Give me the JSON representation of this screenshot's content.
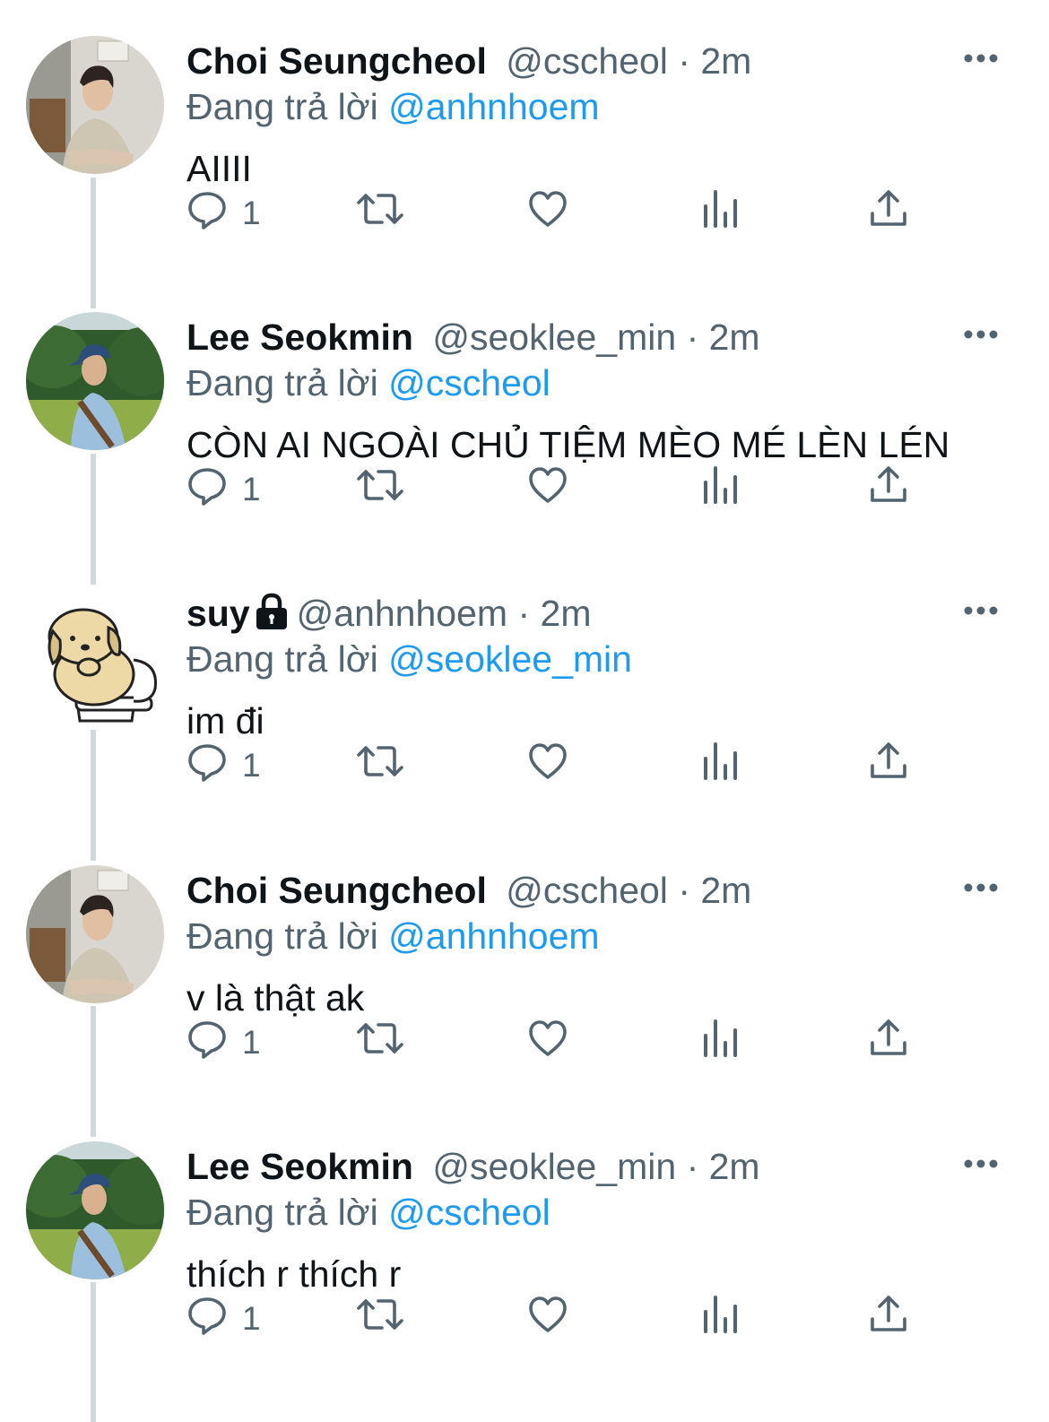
{
  "colors": {
    "text": "#0f1419",
    "secondary": "#536471",
    "mention": "#1d9bf0",
    "thread_line": "#cfd9de"
  },
  "reply_prefix": "Đang trả lời",
  "tweets": [
    {
      "name": "Choi Seungcheol",
      "handle": "@cscheol",
      "sep": "·",
      "time": "2m",
      "reply_to": "@anhnhoem",
      "text": "AIIII",
      "reply_count": "1",
      "avatar": "avatar-photo-man-beige-shirt",
      "locked": false
    },
    {
      "name": "Lee Seokmin",
      "handle": "@seoklee_min",
      "sep": "·",
      "time": "2m",
      "reply_to": "@cscheol",
      "text": "CÒN AI NGOÀI CHỦ TIỆM MÈO MÉ LÈN LÉN",
      "reply_count": "1",
      "avatar": "avatar-photo-man-blue-cap",
      "locked": false
    },
    {
      "name": "suy",
      "handle": "@anhnhoem",
      "sep": "·",
      "time": "2m",
      "reply_to": "@seoklee_min",
      "text": "im đi",
      "reply_count": "1",
      "avatar": "avatar-dog-cartoon",
      "locked": true
    },
    {
      "name": "Choi Seungcheol",
      "handle": "@cscheol",
      "sep": "·",
      "time": "2m",
      "reply_to": "@anhnhoem",
      "text": "v là thật ak",
      "reply_count": "1",
      "avatar": "avatar-photo-man-beige-shirt",
      "locked": false
    },
    {
      "name": "Lee Seokmin",
      "handle": "@seoklee_min",
      "sep": "·",
      "time": "2m",
      "reply_to": "@cscheol",
      "text": "thích r thích r",
      "reply_count": "1",
      "avatar": "avatar-photo-man-blue-cap",
      "locked": false
    }
  ]
}
